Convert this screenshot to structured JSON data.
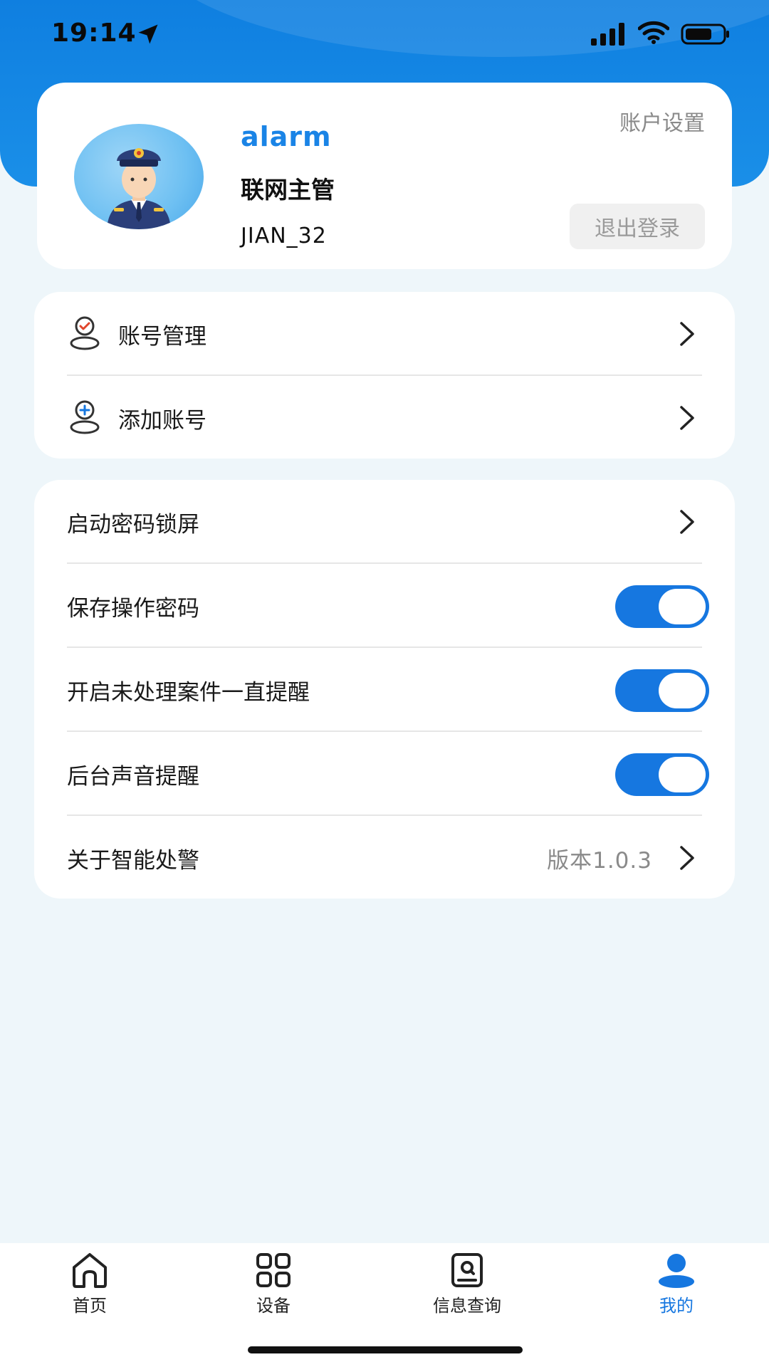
{
  "status_bar": {
    "time": "19:14",
    "icons": [
      "location-arrow-icon",
      "cellular-signal-icon",
      "wifi-icon",
      "battery-icon"
    ]
  },
  "profile": {
    "name": "alarm",
    "role": "联网主管",
    "id": "JIAN_32",
    "account_settings_label": "账户设置",
    "logout_label": "退出登录",
    "avatar_icon": "police-officer-avatar"
  },
  "accounts": {
    "items": [
      {
        "label": "账号管理",
        "icon": "user-check-icon"
      },
      {
        "label": "添加账号",
        "icon": "user-add-icon"
      }
    ]
  },
  "settings": {
    "items": [
      {
        "label": "启动密码锁屏",
        "control": "chevron"
      },
      {
        "label": "保存操作密码",
        "control": "toggle",
        "on": true
      },
      {
        "label": "开启未处理案件一直提醒",
        "control": "toggle",
        "on": true
      },
      {
        "label": "后台声音提醒",
        "control": "toggle",
        "on": true
      },
      {
        "label": "关于智能处警",
        "control": "chevron",
        "value": "版本1.0.3"
      }
    ]
  },
  "tab_bar": {
    "tabs": [
      {
        "label": "首页",
        "icon": "home-icon",
        "active": false
      },
      {
        "label": "设备",
        "icon": "grid-icon",
        "active": false
      },
      {
        "label": "信息查询",
        "icon": "search-card-icon",
        "active": false
      },
      {
        "label": "我的",
        "icon": "person-icon",
        "active": true
      }
    ]
  },
  "colors": {
    "primary": "#1677e0",
    "header_blue": "#1a8fe8",
    "page_bg": "#eef6fa",
    "muted_text": "#8a8a8a"
  }
}
